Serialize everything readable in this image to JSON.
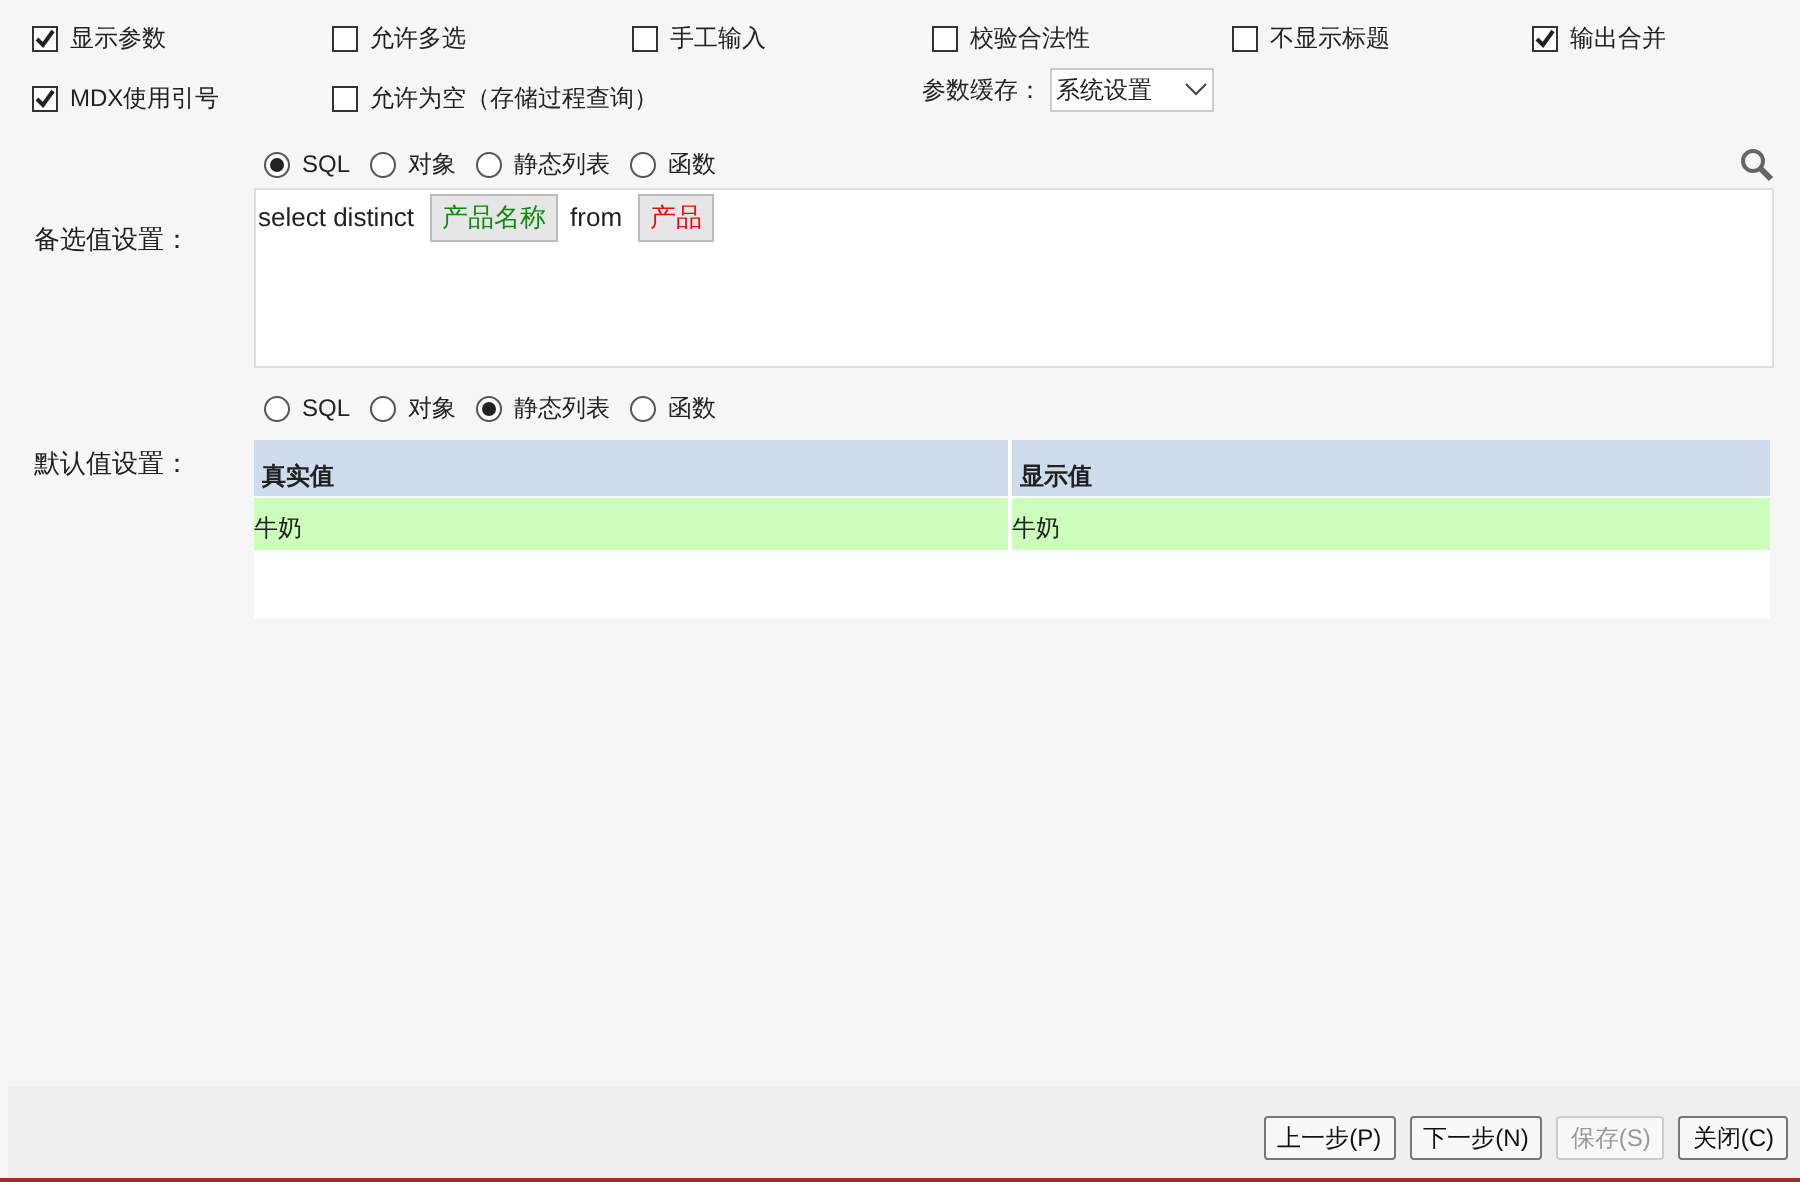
{
  "options": [
    {
      "label": "显示参数",
      "checked": true
    },
    {
      "label": "允许多选",
      "checked": false
    },
    {
      "label": "手工输入",
      "checked": false
    },
    {
      "label": "校验合法性",
      "checked": false
    },
    {
      "label": "不显示标题",
      "checked": false
    },
    {
      "label": "输出合并",
      "checked": true
    },
    {
      "label": "MDX使用引号",
      "checked": true
    },
    {
      "label": "允许为空（存储过程查询）",
      "checked": false
    }
  ],
  "cache": {
    "label": "参数缓存：",
    "value": "系统设置"
  },
  "candidate": {
    "label": "备选值设置：",
    "sources": [
      {
        "label": "SQL",
        "selected": true
      },
      {
        "label": "对象",
        "selected": false
      },
      {
        "label": "静态列表",
        "selected": false
      },
      {
        "label": "函数",
        "selected": false
      }
    ],
    "query": [
      {
        "kind": "text",
        "text": "select distinct"
      },
      {
        "kind": "field",
        "text": "产品名称"
      },
      {
        "kind": "text",
        "text": "from"
      },
      {
        "kind": "table",
        "text": "产品"
      }
    ]
  },
  "default": {
    "label": "默认值设置：",
    "sources": [
      {
        "label": "SQL",
        "selected": false
      },
      {
        "label": "对象",
        "selected": false
      },
      {
        "label": "静态列表",
        "selected": true
      },
      {
        "label": "函数",
        "selected": false
      }
    ],
    "columns": [
      "真实值",
      "显示值"
    ],
    "rows": [
      [
        "牛奶",
        "牛奶"
      ]
    ]
  },
  "buttons": [
    {
      "label": "上一步(P)",
      "disabled": false
    },
    {
      "label": "下一步(N)",
      "disabled": false
    },
    {
      "label": "保存(S)",
      "disabled": true
    },
    {
      "label": "关闭(C)",
      "disabled": false
    }
  ]
}
